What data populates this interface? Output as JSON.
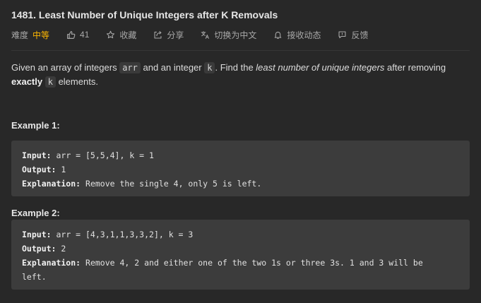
{
  "problem": {
    "title": "1481. Least Number of Unique Integers after K Removals"
  },
  "meta": {
    "difficulty_label": "难度",
    "difficulty_value": "中等",
    "likes": "41",
    "favorite": "收藏",
    "share": "分享",
    "switch_lang": "切换为中文",
    "notifications": "接收动态",
    "feedback": "反馈",
    "colors": {
      "difficulty": "#ffb800"
    }
  },
  "description": {
    "part1": "Given an array of integers ",
    "code_arr": "arr",
    "part2": " and an integer ",
    "code_k1": "k",
    "part3": ". Find the ",
    "emphasis": "least number of unique integers",
    "part4": " after removing",
    "bold": "exactly",
    "part5": " ",
    "code_k2": "k",
    "part6": " elements."
  },
  "examples": [
    {
      "title": "Example 1:",
      "input_key": "Input:",
      "input_val": " arr = [5,5,4], k = 1",
      "output_key": "Output:",
      "output_val": " 1",
      "explanation_key": "Explanation:",
      "explanation_val": " Remove the single 4, only 5 is left."
    },
    {
      "title": "Example 2:",
      "input_key": "Input:",
      "input_val": " arr = [4,3,1,1,3,3,2], k = 3",
      "output_key": "Output:",
      "output_val": " 2",
      "explanation_key": "Explanation:",
      "explanation_val": " Remove 4, 2 and either one of the two 1s or three 3s. 1 and 3 will be",
      "explanation_val_2": "left."
    }
  ],
  "icons": {
    "likes": "thumbs-up-icon",
    "favorite": "star-icon",
    "share": "share-icon",
    "switch_lang": "translate-icon",
    "notifications": "bell-icon",
    "feedback": "feedback-icon"
  }
}
